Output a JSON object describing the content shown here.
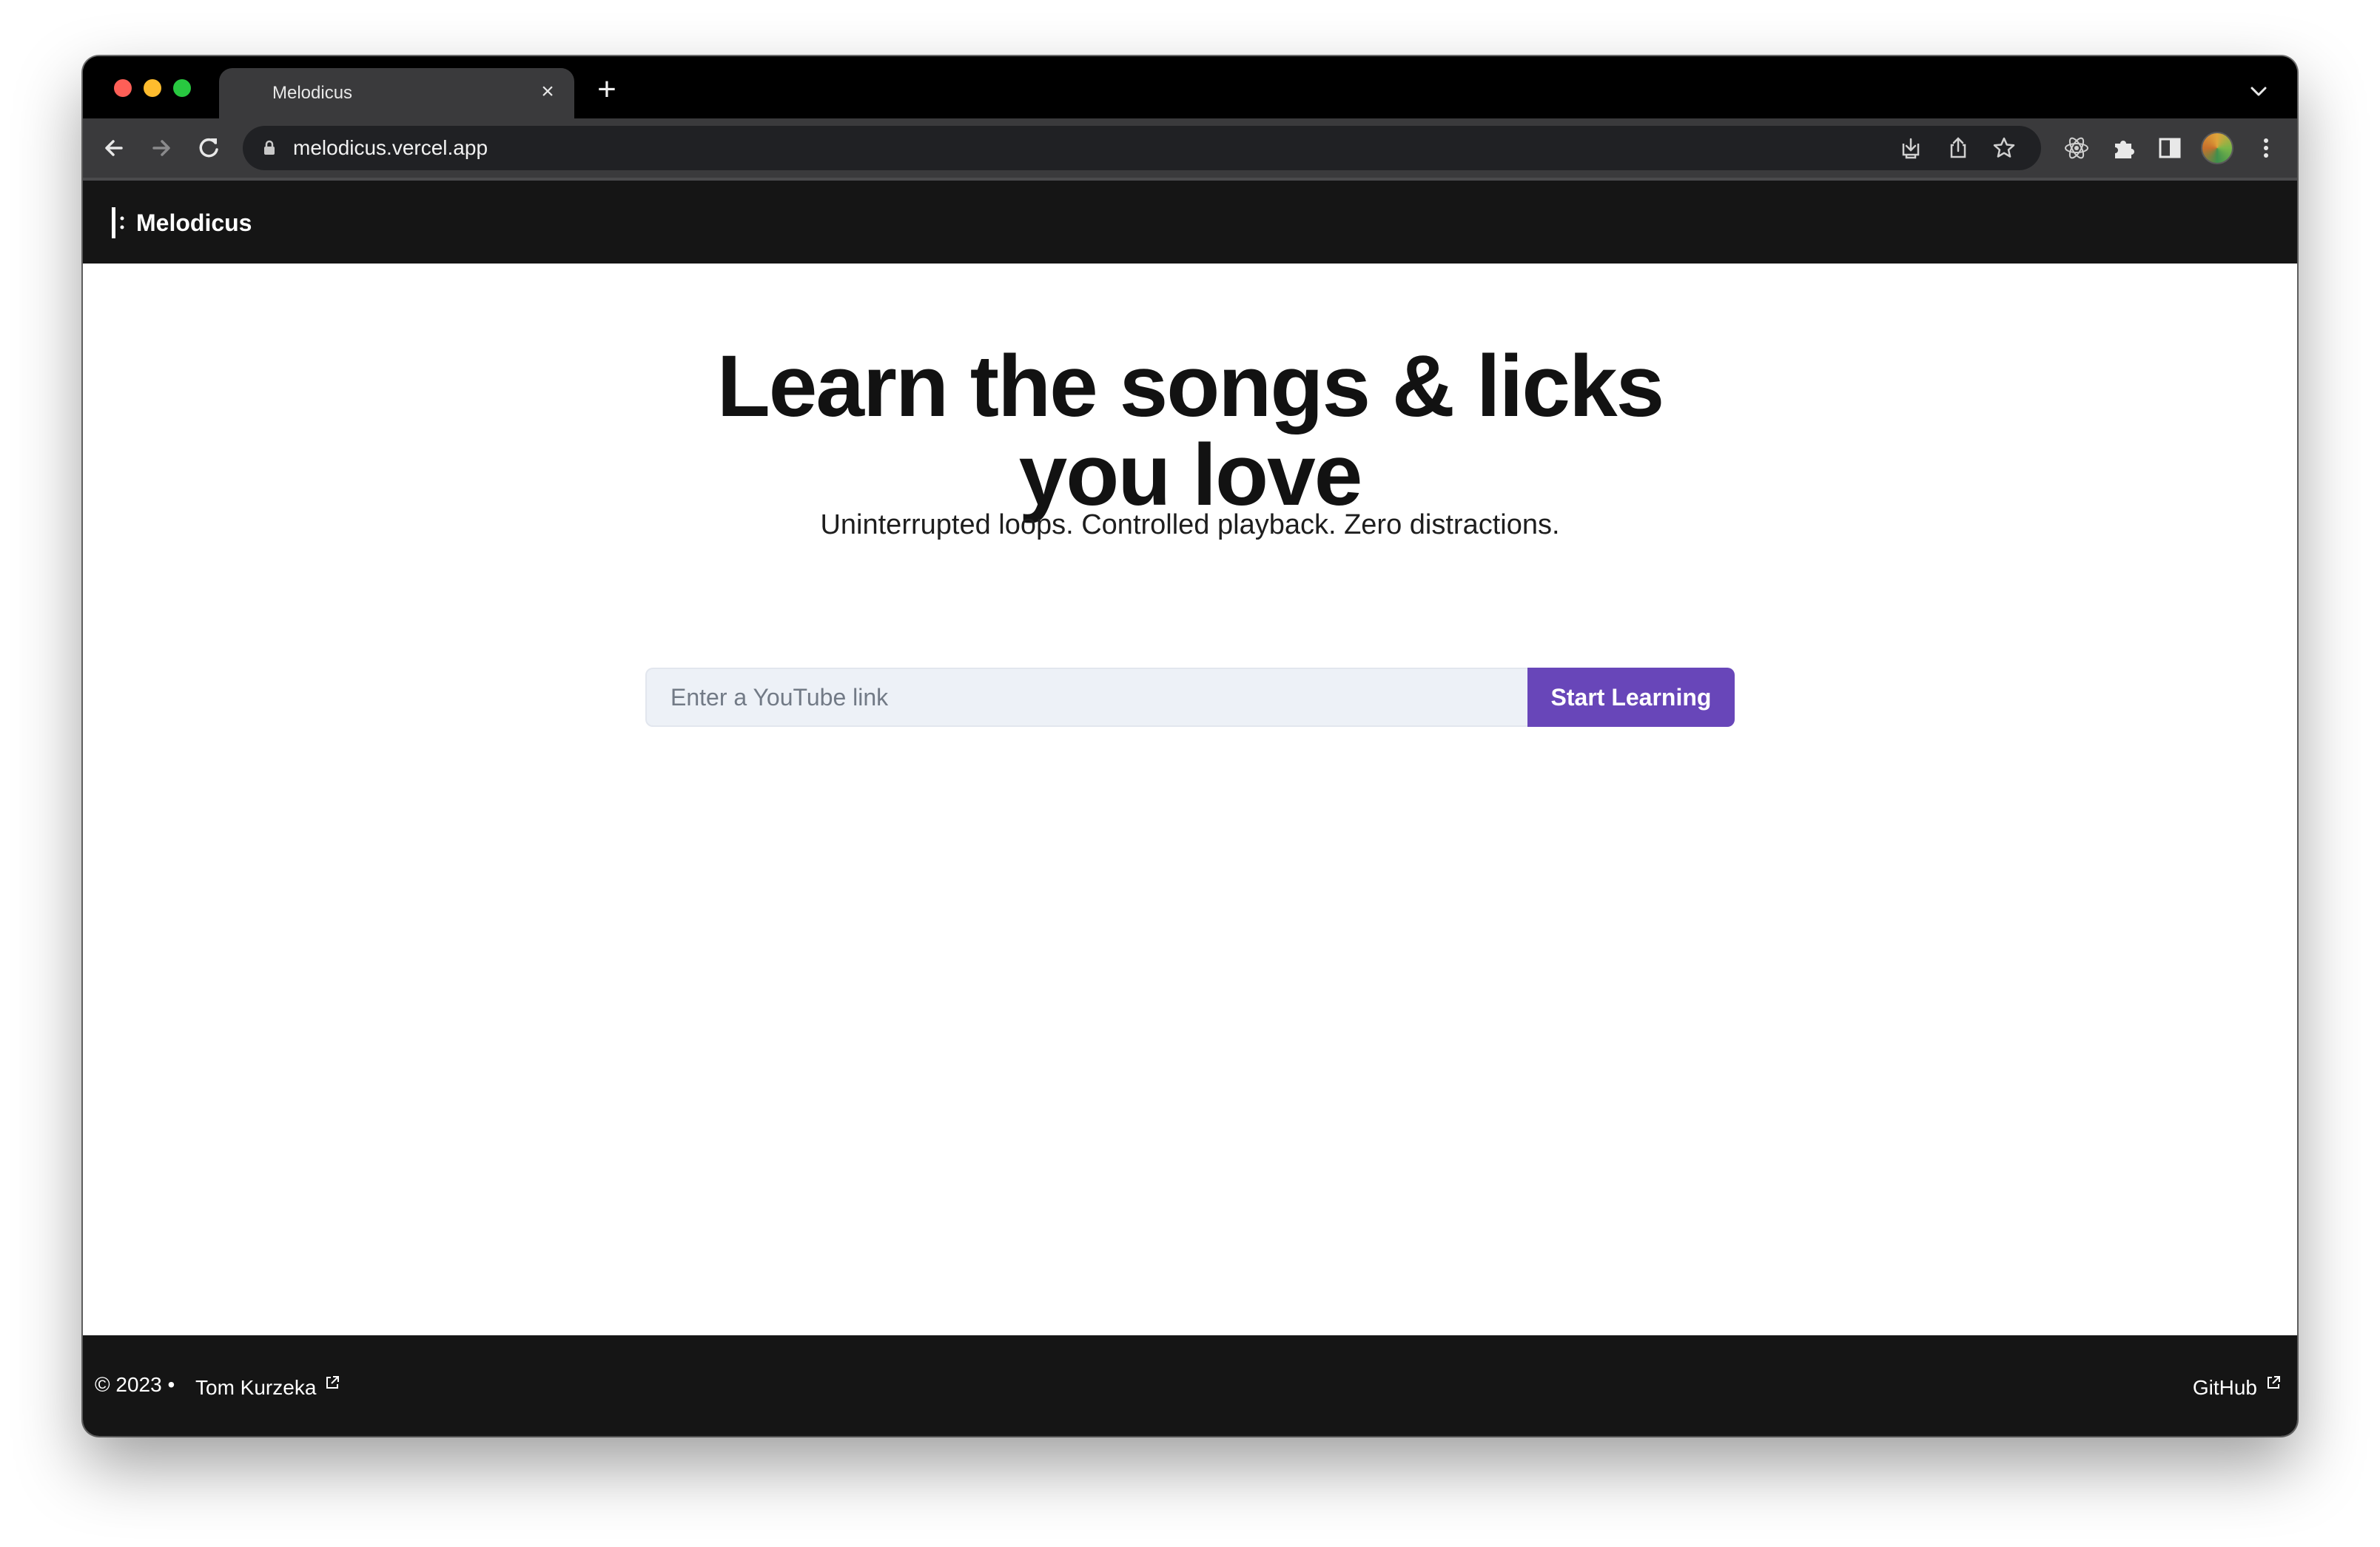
{
  "browser": {
    "tab_title": "Melodicus",
    "url": "melodicus.vercel.app",
    "icons": {
      "back": "arrow-left-icon",
      "forward": "arrow-right-icon",
      "reload": "reload-icon",
      "lock": "lock-icon",
      "install": "install-app-icon",
      "share": "share-icon",
      "bookmark": "star-icon",
      "react_devtools": "react-icon",
      "extensions": "puzzle-icon",
      "side_panel": "side-panel-icon",
      "menu": "kebab-menu-icon"
    }
  },
  "site": {
    "brand": "Melodicus",
    "hero_line1": "Learn the songs & licks",
    "hero_line2": "you love",
    "subtitle": "Uninterrupted loops. Controlled playback. Zero distractions.",
    "input_placeholder": "Enter a YouTube link",
    "input_value": "",
    "button_label": "Start Learning",
    "accent_color": "#6846b9"
  },
  "footer": {
    "copyright": "© 2023 •",
    "author": "Tom Kurzeka",
    "github": "GitHub"
  }
}
